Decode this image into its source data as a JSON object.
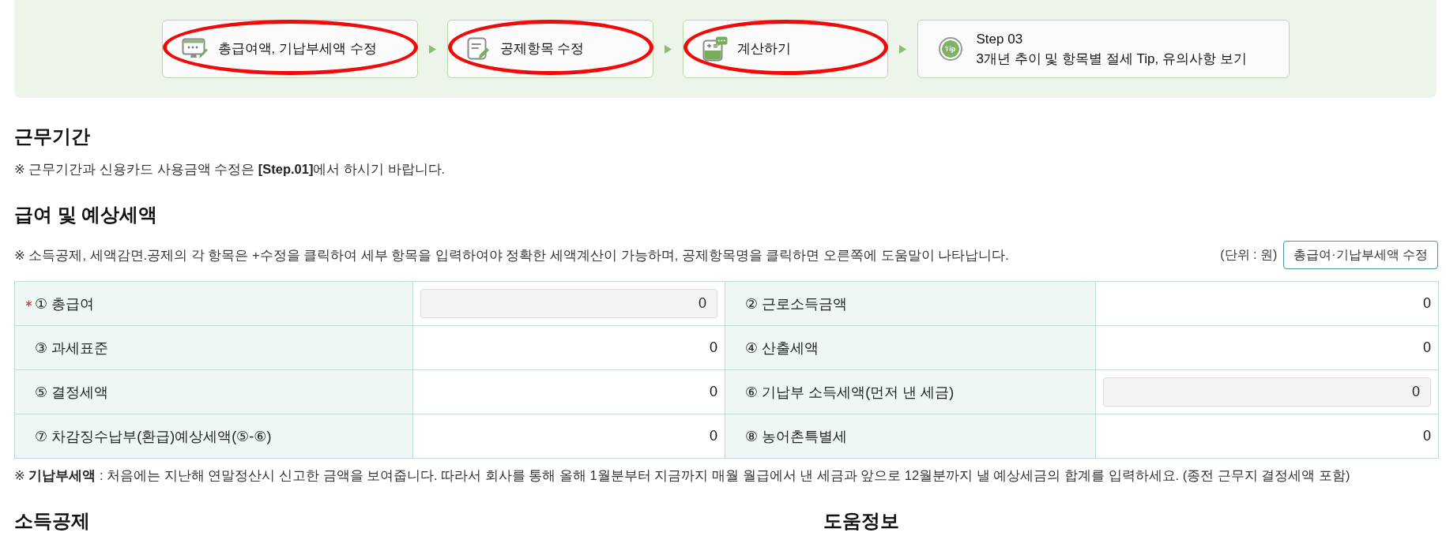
{
  "steps": [
    {
      "kind": "icon",
      "label": "총급여액, 기납부세액 수정",
      "circled": true
    },
    {
      "kind": "icon",
      "label": "공제항목 수정",
      "circled": true
    },
    {
      "kind": "icon",
      "label": "계산하기",
      "circled": true
    },
    {
      "kind": "badge",
      "badge": "Tip",
      "title": "Step 03",
      "label": "3개년 추이 및 항목별 절세 Tip, 유의사항 보기",
      "circled": false
    }
  ],
  "work_period": {
    "heading": "근무기간",
    "note": "※ 근무기간과 신용카드 사용금액 수정은 **[Step.01]**에서 하시기 바랍니다."
  },
  "salary": {
    "heading": "급여 및 예상세액",
    "note": "※ 소득공제, 세액감면.공제의 각 항목은 +수정을 클릭하여 세부 항목을 입력하여야 정확한 세액계산이 가능하며, 공제항목명을 클릭하면 오른쪽에 도움말이 나타납니다.",
    "unit": "(단위 : 원)",
    "button": "총급여·기납부세액 수정",
    "rows": [
      [
        {
          "label": "① 총급여",
          "required": true,
          "kind": "input",
          "value": "0"
        },
        {
          "label": "② 근로소득금액",
          "required": false,
          "kind": "text",
          "value": "0"
        }
      ],
      [
        {
          "label": "③ 과세표준",
          "required": false,
          "kind": "text",
          "value": "0"
        },
        {
          "label": "④ 산출세액",
          "required": false,
          "kind": "text",
          "value": "0"
        }
      ],
      [
        {
          "label": "⑤ 결정세액",
          "required": false,
          "kind": "text",
          "value": "0"
        },
        {
          "label": "⑥ 기납부 소득세액(먼저 낸 세금)",
          "required": false,
          "kind": "input",
          "value": "0"
        }
      ],
      [
        {
          "label": "⑦ 차감징수납부(환급)예상세액(⑤-⑥)",
          "required": false,
          "kind": "text",
          "value": "0"
        },
        {
          "label": "⑧ 농어촌특별세",
          "required": false,
          "kind": "text",
          "value": "0"
        }
      ]
    ],
    "footnote": "※ **기납부세액** : 처음에는 지난해 연말정산시 신고한 금액을 보여줍니다. 따라서 회사를 통해 올해 1월분부터 지금까지 매월 월급에서 낸 세금과 앞으로 12월분까지 낼 예상세금의 합계를 입력하세요. (종전 근무지 결정세액 포함)"
  },
  "bottom_headings": [
    "소득공제",
    "도움정보"
  ]
}
